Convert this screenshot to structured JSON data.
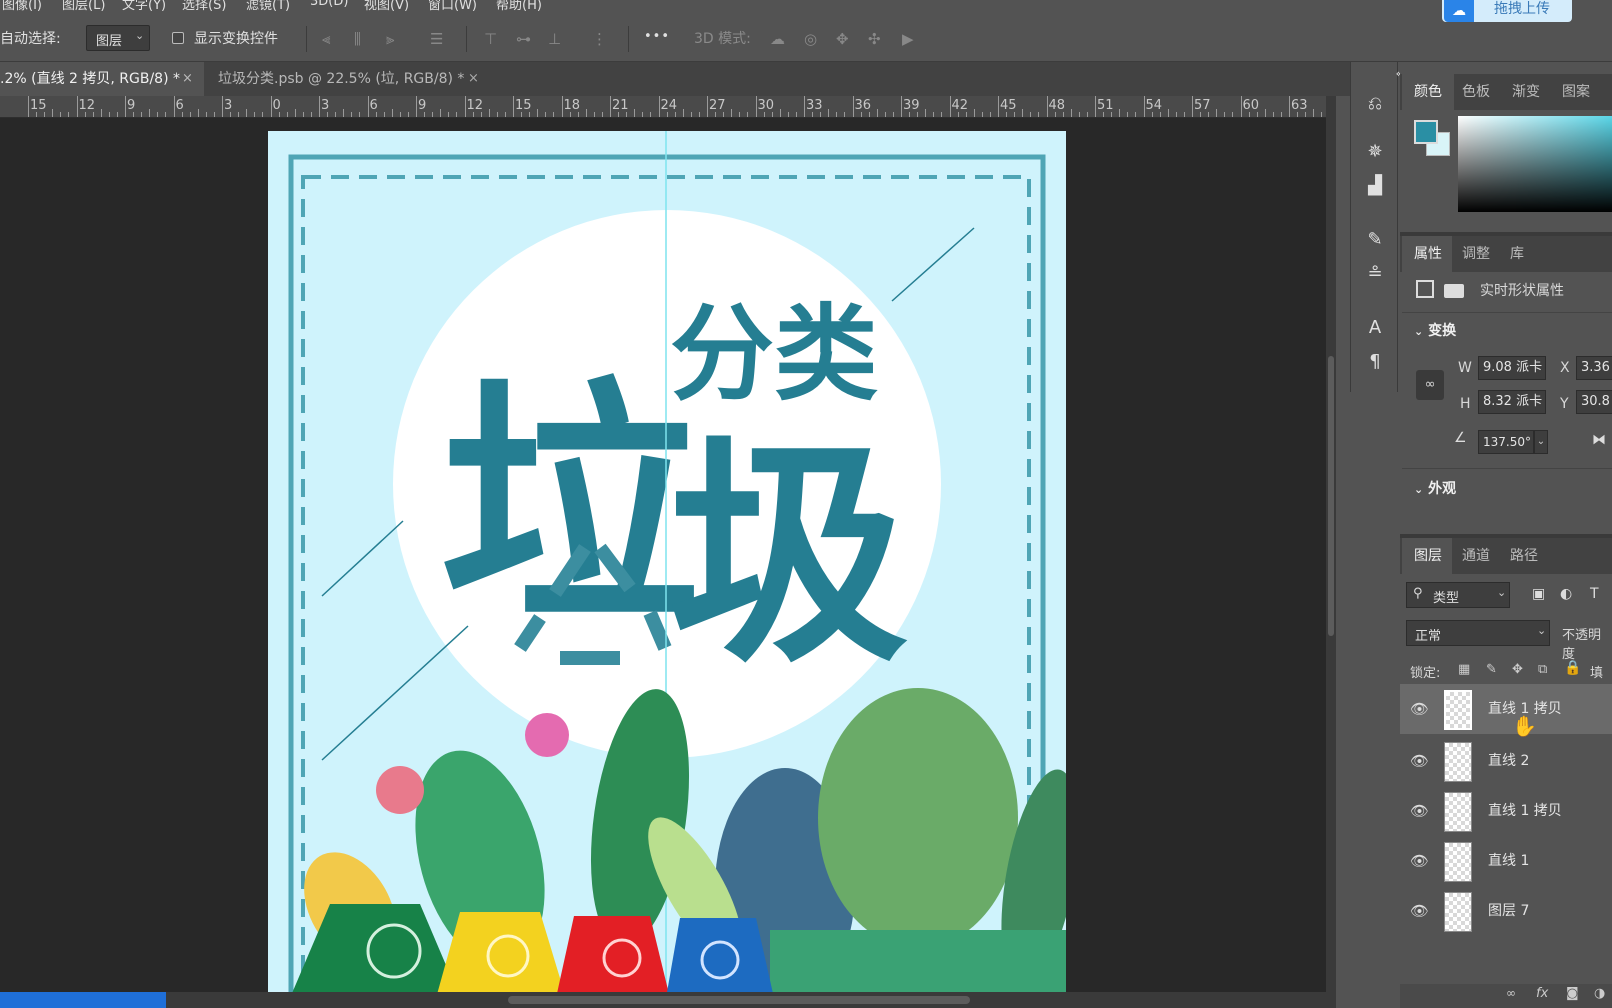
{
  "menubar": {
    "items": [
      "图像(I)",
      "图层(L)",
      "文字(Y)",
      "选择(S)",
      "滤镜(T)",
      "3D(D)",
      "视图(V)",
      "窗口(W)",
      "帮助(H)"
    ]
  },
  "upload_button": {
    "label": "拖拽上传"
  },
  "options_bar": {
    "auto_select_label": "自动选择:",
    "auto_select_value": "图层",
    "show_transform_label": "显示变换控件",
    "more_label": "•••",
    "mode_3d_label": "3D 模式:"
  },
  "doc_tabs": [
    {
      "title": ".2% (直线 2 拷贝, RGB/8) *",
      "close": "×"
    },
    {
      "title": "垃圾分类.psb @ 22.5% (垃, RGB/8) *",
      "close": "×"
    }
  ],
  "ruler": {
    "ticks": [
      "15",
      "12",
      "9",
      "6",
      "3",
      "0",
      "3",
      "6",
      "9",
      "12",
      "15",
      "18",
      "21",
      "24",
      "27",
      "30",
      "33",
      "36",
      "39",
      "42",
      "45",
      "48",
      "51",
      "54",
      "57",
      "60",
      "63"
    ]
  },
  "artwork": {
    "title_chars": [
      "垃",
      "分类",
      "圾"
    ],
    "colors": {
      "background": "#cff3fc",
      "accent": "#257e92",
      "guide": "#7ee4ee",
      "circle": "#ffffff",
      "bin_green": "#178248",
      "bin_yellow": "#f3d21f",
      "bin_red": "#e31f25",
      "bin_blue": "#1d6bc1"
    }
  },
  "color_panel": {
    "tabs": [
      "颜色",
      "色板",
      "渐变",
      "图案"
    ],
    "foreground": "#2a8fa4",
    "background": "#d9f4f8"
  },
  "properties_panel": {
    "tabs": [
      "属性",
      "调整",
      "库"
    ],
    "subtitle": "实时形状属性",
    "transform_label": "变换",
    "w_label": "W",
    "w_value": "9.08 派卡",
    "h_label": "H",
    "h_value": "8.32 派卡",
    "x_label": "X",
    "x_value": "3.36",
    "y_label": "Y",
    "y_value": "30.8",
    "angle_value": "137.50°",
    "appearance_label": "外观"
  },
  "layers_panel": {
    "tabs": [
      "图层",
      "通道",
      "路径"
    ],
    "filter_label": "类型",
    "blend_mode": "正常",
    "opacity_label": "不透明度",
    "lock_label": "锁定:",
    "fill_label": "填充",
    "layers": [
      {
        "name": "直线 1 拷贝",
        "selected": true
      },
      {
        "name": "直线 2",
        "selected": false
      },
      {
        "name": "直线 1 拷贝",
        "selected": false
      },
      {
        "name": "直线 1",
        "selected": false
      },
      {
        "name": "图层 7",
        "selected": false
      }
    ]
  }
}
